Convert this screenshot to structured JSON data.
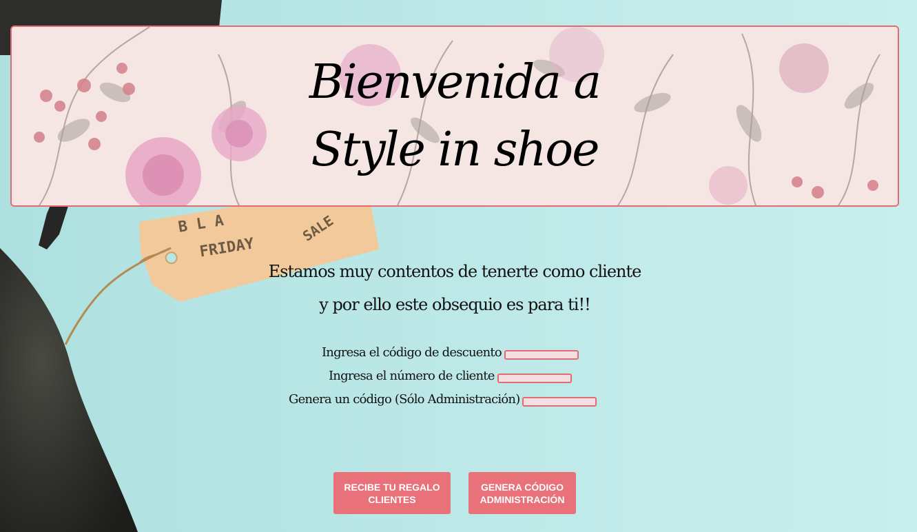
{
  "banner": {
    "title_line1": "Bienvenida a",
    "title_line2": "Style in shoe"
  },
  "background": {
    "tag_text_top": "B L A",
    "tag_text_main": "FRIDAY",
    "tag_text_side": "SALE"
  },
  "welcome": {
    "line1": "Estamos muy contentos de tenerte como cliente",
    "line2": "y por ello este obsequio es para ti!!"
  },
  "form": {
    "discount_code_label": "Ingresa el código de descuento",
    "discount_code_value": "",
    "customer_number_label": "Ingresa el número de cliente",
    "customer_number_value": "",
    "generate_code_label": "Genera un código (Sólo Administración)",
    "generate_code_value": ""
  },
  "buttons": {
    "clientes_line1": "RECIBE TU REGALO",
    "clientes_line2": "CLIENTES",
    "admin_line1": "GENERA CÓDIGO",
    "admin_line2": "ADMINISTRACIÓN"
  },
  "colors": {
    "accent": "#e8717a",
    "border": "#e06b72",
    "background": "#b8e6e5"
  }
}
